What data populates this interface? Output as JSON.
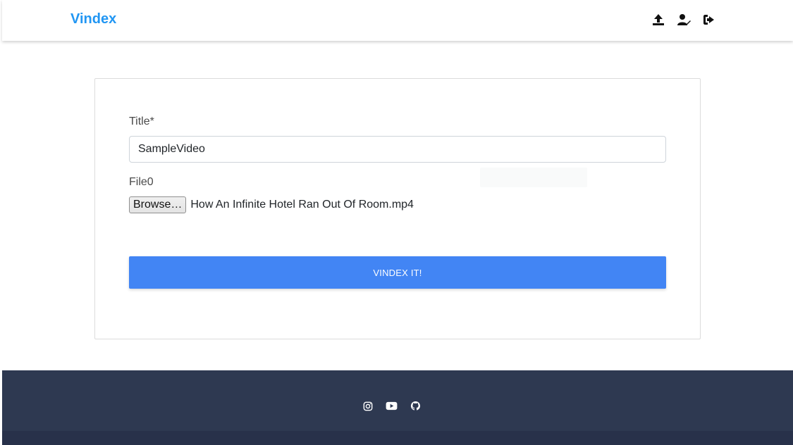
{
  "app": {
    "brand": "Vindex"
  },
  "nav": {
    "icons": [
      "upload-icon",
      "user-edit-icon",
      "sign-out-icon"
    ]
  },
  "form": {
    "title_label": "Title*",
    "title_value": "SampleVideo",
    "file_label": "File0",
    "browse_label": "Browse…",
    "file_name": "How An Infinite Hotel Ran Out Of Room.mp4",
    "submit_label": "VINDEX IT!"
  },
  "footer": {
    "icons": [
      "instagram-icon",
      "youtube-icon",
      "github-icon"
    ]
  },
  "colors": {
    "brand": "#2196f3",
    "primary_button": "#4285f4",
    "footer_bg": "#2e3951",
    "footer_bottom_bg": "#28314a"
  }
}
